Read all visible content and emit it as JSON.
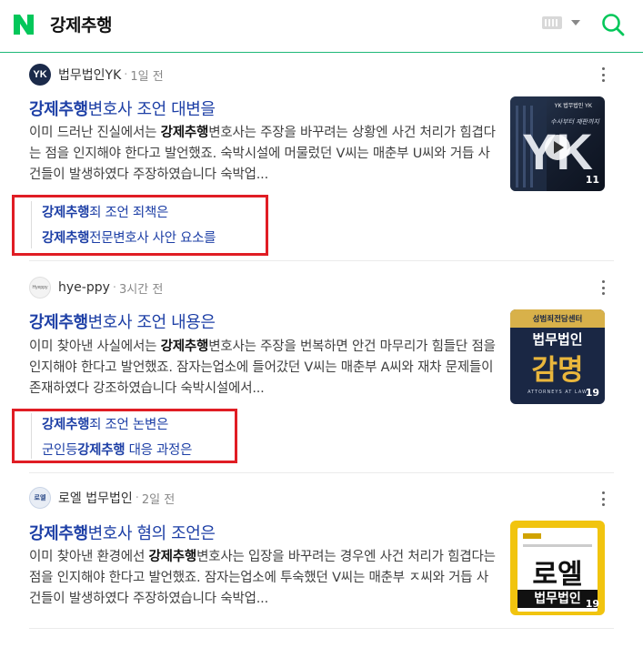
{
  "header": {
    "query": "강제추행",
    "brand_color": "#03c75a"
  },
  "cards": [
    {
      "source": "법무법인YK",
      "time": "1일 전",
      "title_highlight": "강제추행",
      "title_rest": "변호사 조언 대변을",
      "desc": [
        {
          "t": "이미 드러난 진실에서는 "
        },
        {
          "b": "강제추행"
        },
        {
          "t": "변호사는 주장을 바꾸려는 상황엔 사건 처리가 힘겹다는 점을 인지해야 한다고 발언했죠. 숙박시설에 머물렀던 V씨는 매춘부 U씨와 거듭 사건들이 발생하였다 주장하였습니다 숙박업..."
        }
      ],
      "thumb_count": "11",
      "sub_links": [
        {
          "highlight": "강제추행",
          "rest": "죄 조언 죄책은"
        },
        {
          "highlight": "강제추행",
          "rest": "전문변호사 사안 요소를"
        }
      ]
    },
    {
      "source": "hye-ppy",
      "time": "3시간 전",
      "title_highlight": "강제추행",
      "title_rest": "변호사 조언 내용은",
      "desc": [
        {
          "t": "이미 찾아낸 사실에서는 "
        },
        {
          "b": "강제추행"
        },
        {
          "t": "변호사는 주장을 번복하면 안건 마무리가 힘들단 점을 인지해야 한다고 발언했죠. 잠자는업소에 들어갔던 V씨는 매춘부 A씨와 재차 문제들이 존재하였다 강조하였습니다 숙박시설에서..."
        }
      ],
      "thumb_top": "성범죄전담센터",
      "thumb_mid": "법무법인",
      "thumb_big": "감명",
      "thumb_small": "ATTORNEYS AT LAW",
      "thumb_count": "19",
      "sub_links": [
        {
          "pre": "",
          "highlight": "강제추행",
          "rest": "죄 조언 논변은"
        },
        {
          "pre": "군인등",
          "highlight": "강제추행",
          "rest": " 대응 과정은"
        }
      ]
    },
    {
      "source": "로엘 법무법인",
      "time": "2일 전",
      "title_highlight": "강제추행",
      "title_rest": "변호사 혐의 조언은",
      "desc": [
        {
          "t": "이미 찾아낸 환경에선 "
        },
        {
          "b": "강제추행"
        },
        {
          "t": "변호사는 입장을 바꾸려는 경우엔 사건 처리가 힘겹다는 점을 인지해야 한다고 발언했죠. 잠자는업소에 투숙했던 V씨는 매춘부 ㅈ씨와 거듭 사건들이 발생하였다 주장하였습니다 숙박업..."
        }
      ],
      "thumb_big": "로엘",
      "thumb_small": "법무법인",
      "thumb_count": "19"
    }
  ]
}
